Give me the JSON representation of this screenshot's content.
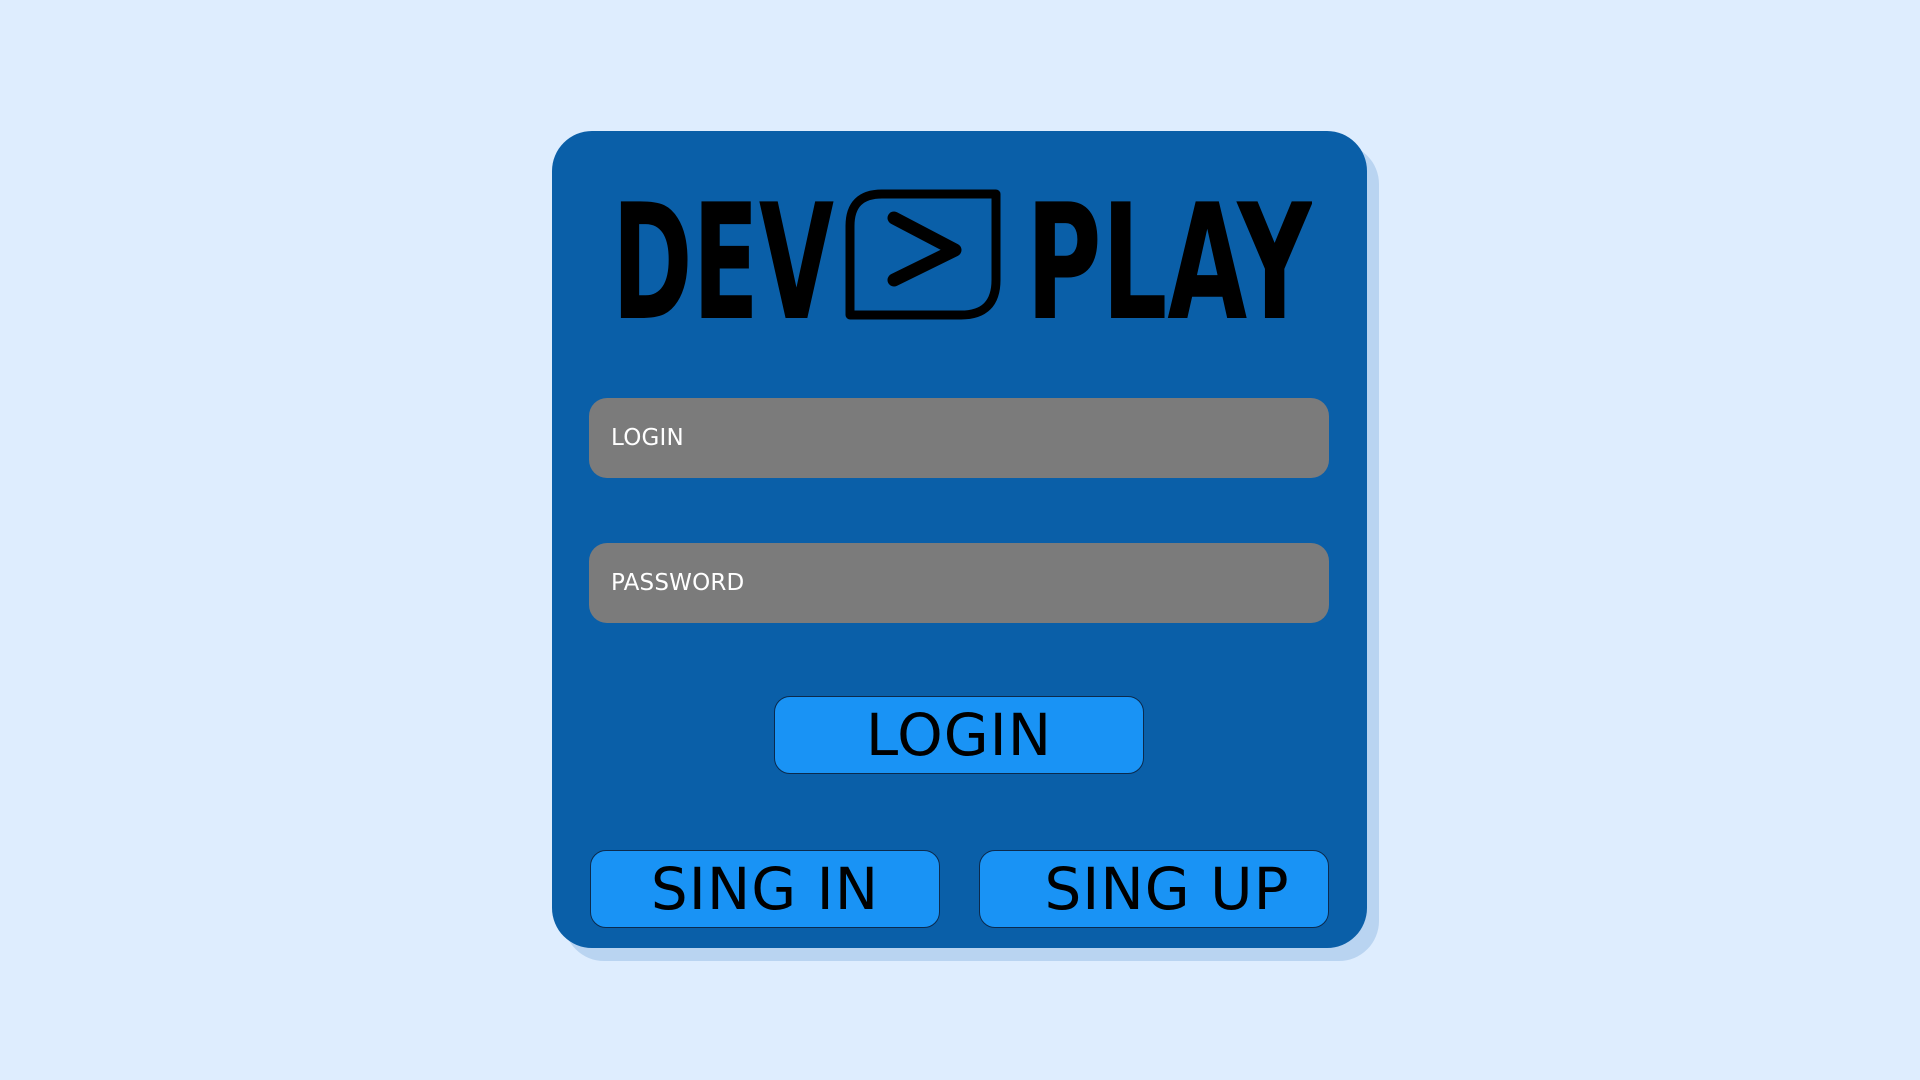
{
  "colors": {
    "background": "#deedfe",
    "card": "#0a5fa8",
    "card_shadow": "#b9d4f1",
    "input": "#7b7b7b",
    "button": "#1993f5"
  },
  "logo": {
    "left_text": "DEV",
    "right_text": "PLAY",
    "icon": "play-button-icon"
  },
  "form": {
    "login_placeholder": "LOGIN",
    "password_placeholder": "PASSWORD"
  },
  "buttons": {
    "login": "LOGIN",
    "sign_in": "SING IN",
    "sign_up": "SING UP"
  }
}
